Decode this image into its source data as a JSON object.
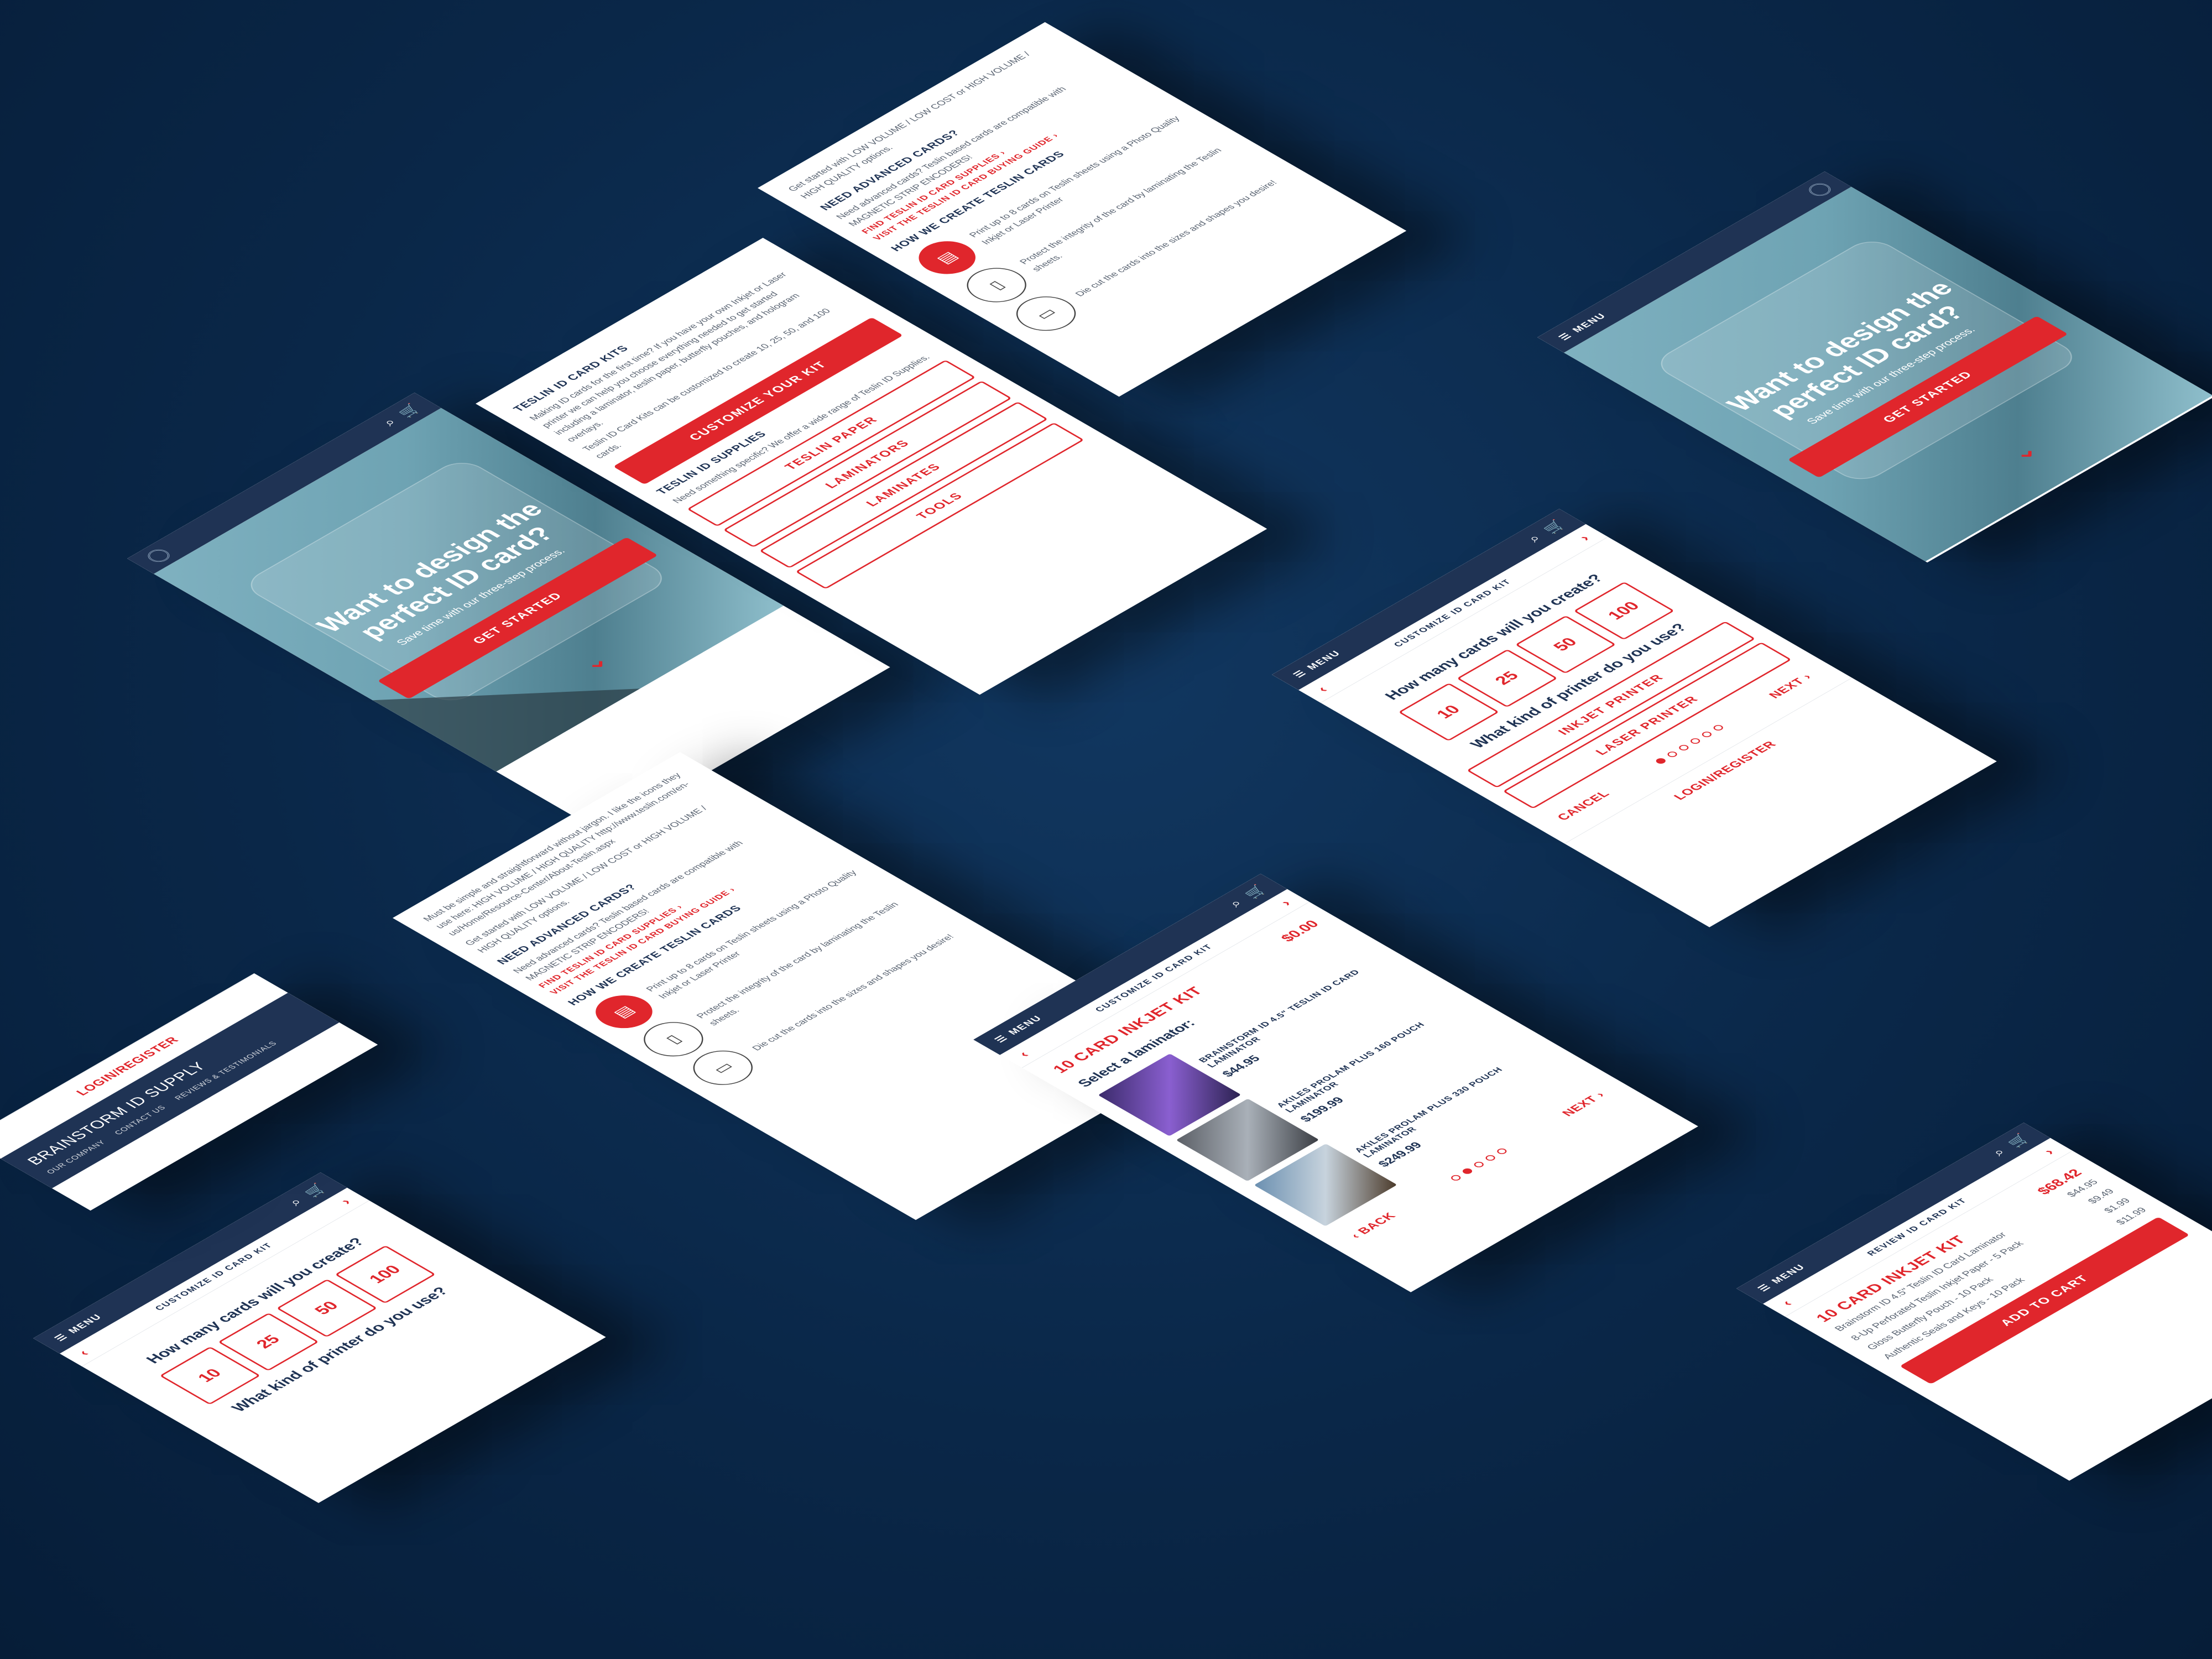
{
  "header": {
    "menu_label": "MENU",
    "subtitle_customize": "CUSTOMIZE ID CARD KIT",
    "subtitle_review": "REVIEW ID CARD KIT"
  },
  "hero": {
    "title_line1": "Want to design the",
    "title_line2": "perfect ID card?",
    "subtitle": "Save time with our three-step process.",
    "cta": "GET STARTED"
  },
  "kits": {
    "title": "TESLIN ID CARD KITS",
    "body1": "Making ID cards for the first time? If you have your own Inkjet or Laser printer we can help you choose everything needed to get started including a laminator, teslin paper, butterfly pouches, and hologram overlays.",
    "body2": "Teslin ID Card Kits can be customized to create 10, 25, 50, and 100 cards.",
    "cta": "CUSTOMIZE YOUR KIT"
  },
  "supplies": {
    "title": "TESLIN ID SUPPLIES",
    "body": "Need something specific? We offer a wide range of Teslin ID Supplies.",
    "items": [
      "TESLIN PAPER",
      "LAMINATORS",
      "LAMINATES",
      "TOOLS"
    ]
  },
  "info": {
    "text1": "Must be simple and straightforward without jargon. I like the icons they use here: HIGH VOLUME / HIGH QUALITY http://www.teslin.com/en-us/Home/Resource-Center/About-Teslin.aspx",
    "text2": "Get started with LOW VOLUME / LOW COST or HIGH VOLUME / HIGH QUALITY options.",
    "adv_title": "NEED ADVANCED CARDS?",
    "adv_body": "Need advanced cards? Teslin based cards are compatible with MAGNETIC STRIP ENCODERS!",
    "link1": "FIND TESLIN ID CARD SUPPLIES ›",
    "link2": "VISIT THE TESLIN ID CARD BUYING GUIDE ›",
    "how_title": "HOW WE CREATE TESLIN CARDS",
    "steps": [
      "Print up to 8 cards on Teslin sheets using a Photo Quality Inkjet or Laser Printer",
      "Protect the integrity of the card by laminating the Teslin sheets.",
      "Die cut the cards into the sizes and shapes you desire!"
    ]
  },
  "wizard": {
    "q1": "How many cards will you create?",
    "counts": [
      "10",
      "25",
      "50",
      "100"
    ],
    "q2": "What kind of printer do you use?",
    "printers": [
      "INKJET PRINTER",
      "LASER PRINTER"
    ],
    "cancel": "CANCEL",
    "next": "NEXT ›",
    "back": "‹ BACK",
    "login": "LOGIN/REGISTER"
  },
  "kit": {
    "title": "10 CARD INKJET KIT",
    "price": "$0.00",
    "select": "Select a laminator:",
    "products": [
      {
        "name": "BRAINSTORM ID 4.5\" TESLIN ID CARD LAMINATOR",
        "price": "$44.95"
      },
      {
        "name": "AKILES PROLAM PLUS 160 POUCH LAMINATOR",
        "price": "$199.99"
      },
      {
        "name": "AKILES PROLAM PLUS 330 POUCH LAMINATOR",
        "price": "$249.99"
      }
    ]
  },
  "review": {
    "title": "10 CARD INKJET KIT",
    "price": "$68.42",
    "items": [
      {
        "name": "Brainstorm ID 4.5\" Teslin ID Card Laminator",
        "price": "$44.95"
      },
      {
        "name": "8-Up Perforated Teslin Inkjet Paper - 5 Pack",
        "price": "$9.49"
      },
      {
        "name": "Gloss Butterfly Pouch - 10 Pack",
        "price": "$1.99"
      },
      {
        "name": "Authentic Seals and Keys - 10 Pack",
        "price": "$11.99"
      }
    ],
    "cta": "ADD TO CART"
  },
  "footer": {
    "brand": "BRAINSTORM ID SUPPLY",
    "links": [
      "OUR COMPANY",
      "CONTACT US",
      "REVIEWS & TESTIMONIALS"
    ]
  },
  "colors": {
    "accent": "#e0262c",
    "navy": "#1f3354",
    "background": "#0a2748"
  }
}
